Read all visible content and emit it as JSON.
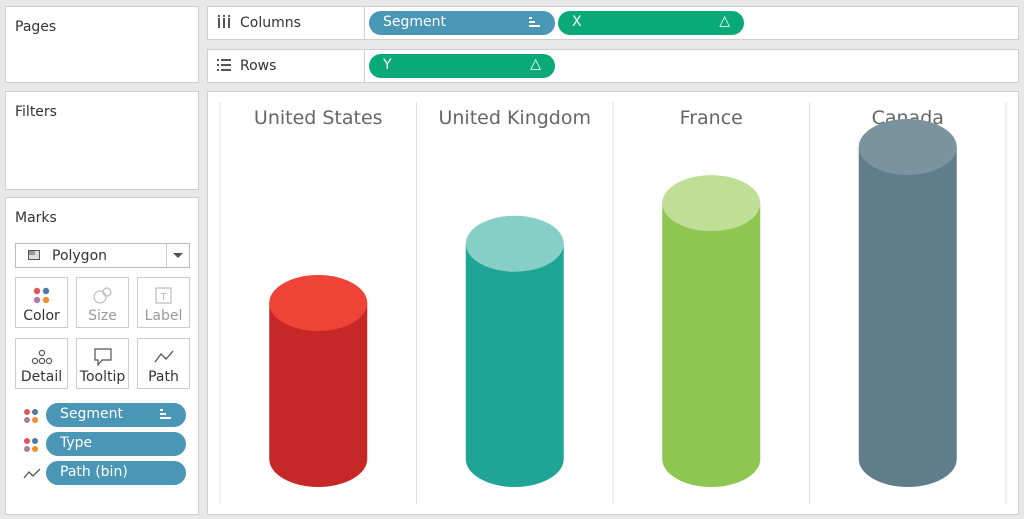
{
  "cards": {
    "pages": {
      "title": "Pages"
    },
    "filters": {
      "title": "Filters"
    },
    "marks": {
      "title": "Marks",
      "mark_type": "Polygon",
      "buttons": [
        {
          "label": "Color",
          "icon": "color-icon",
          "enabled": true
        },
        {
          "label": "Size",
          "icon": "size-icon",
          "enabled": false
        },
        {
          "label": "Label",
          "icon": "label-icon",
          "enabled": false
        },
        {
          "label": "Detail",
          "icon": "detail-icon",
          "enabled": true
        },
        {
          "label": "Tooltip",
          "icon": "tooltip-icon",
          "enabled": true
        },
        {
          "label": "Path",
          "icon": "path-icon",
          "enabled": true
        }
      ],
      "fields": [
        {
          "label": "Segment",
          "icon": "color-icon",
          "sort_icon": "sort-icon"
        },
        {
          "label": "Type",
          "icon": "color-icon"
        },
        {
          "label": "Path (bin)",
          "icon": "path-icon"
        }
      ]
    }
  },
  "shelves": {
    "columns": {
      "label": "Columns",
      "icon": "columns-icon",
      "pills": [
        {
          "label": "Segment",
          "kind": "dimension",
          "icon": "sort-icon"
        },
        {
          "label": "X",
          "kind": "measure",
          "icon": "delta-icon"
        }
      ]
    },
    "rows": {
      "label": "Rows",
      "icon": "rows-icon",
      "pills": [
        {
          "label": "Y",
          "kind": "measure",
          "icon": "delta-icon"
        }
      ]
    }
  },
  "chart_data": {
    "type": "bar",
    "style": "3d-cylinder",
    "categories": [
      "United States",
      "United Kingdom",
      "France",
      "Canada"
    ],
    "values": [
      50,
      69,
      82,
      100
    ],
    "colors": {
      "United States": {
        "body": "#c62828",
        "top": "#f04338"
      },
      "United Kingdom": {
        "body": "#1fa596",
        "top": "#85cfc7"
      },
      "France": {
        "body": "#8fc652",
        "top": "#bfdf97"
      },
      "Canada": {
        "body": "#607d8b",
        "top": "#7a939f"
      }
    },
    "title": "",
    "xlabel": "",
    "ylabel": "",
    "grid": false
  },
  "colors": {
    "dimension_pill": "#4a96b6",
    "measure_pill": "#0aaa76"
  }
}
